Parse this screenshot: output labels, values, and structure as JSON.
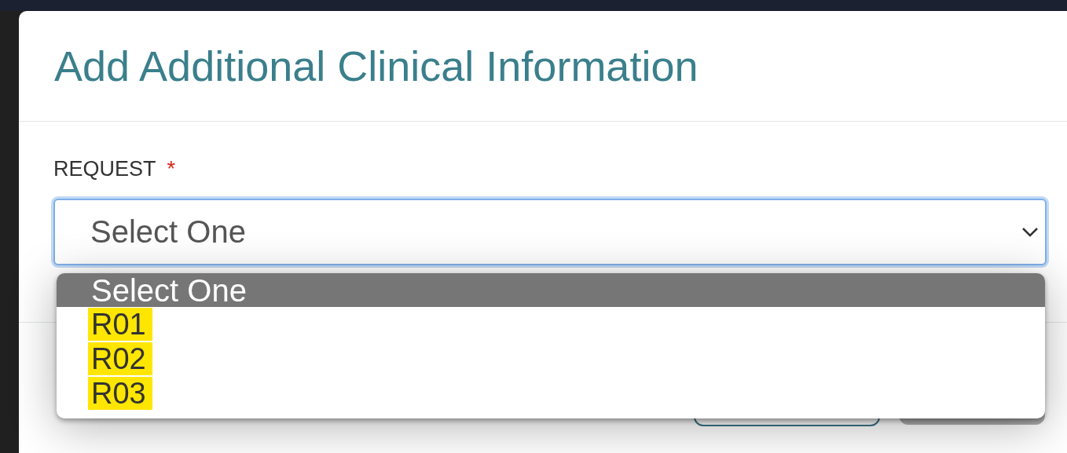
{
  "dialog": {
    "title": "Add Additional Clinical Information"
  },
  "request": {
    "label": "REQUEST",
    "required_mark": "*",
    "value": "Select One",
    "expanded": true,
    "options": [
      {
        "label": "Select One",
        "selected": true,
        "highlighted": false
      },
      {
        "label": "R01",
        "selected": false,
        "highlighted": true
      },
      {
        "label": "R02",
        "selected": false,
        "highlighted": true
      },
      {
        "label": "R03",
        "selected": false,
        "highlighted": true
      }
    ]
  }
}
